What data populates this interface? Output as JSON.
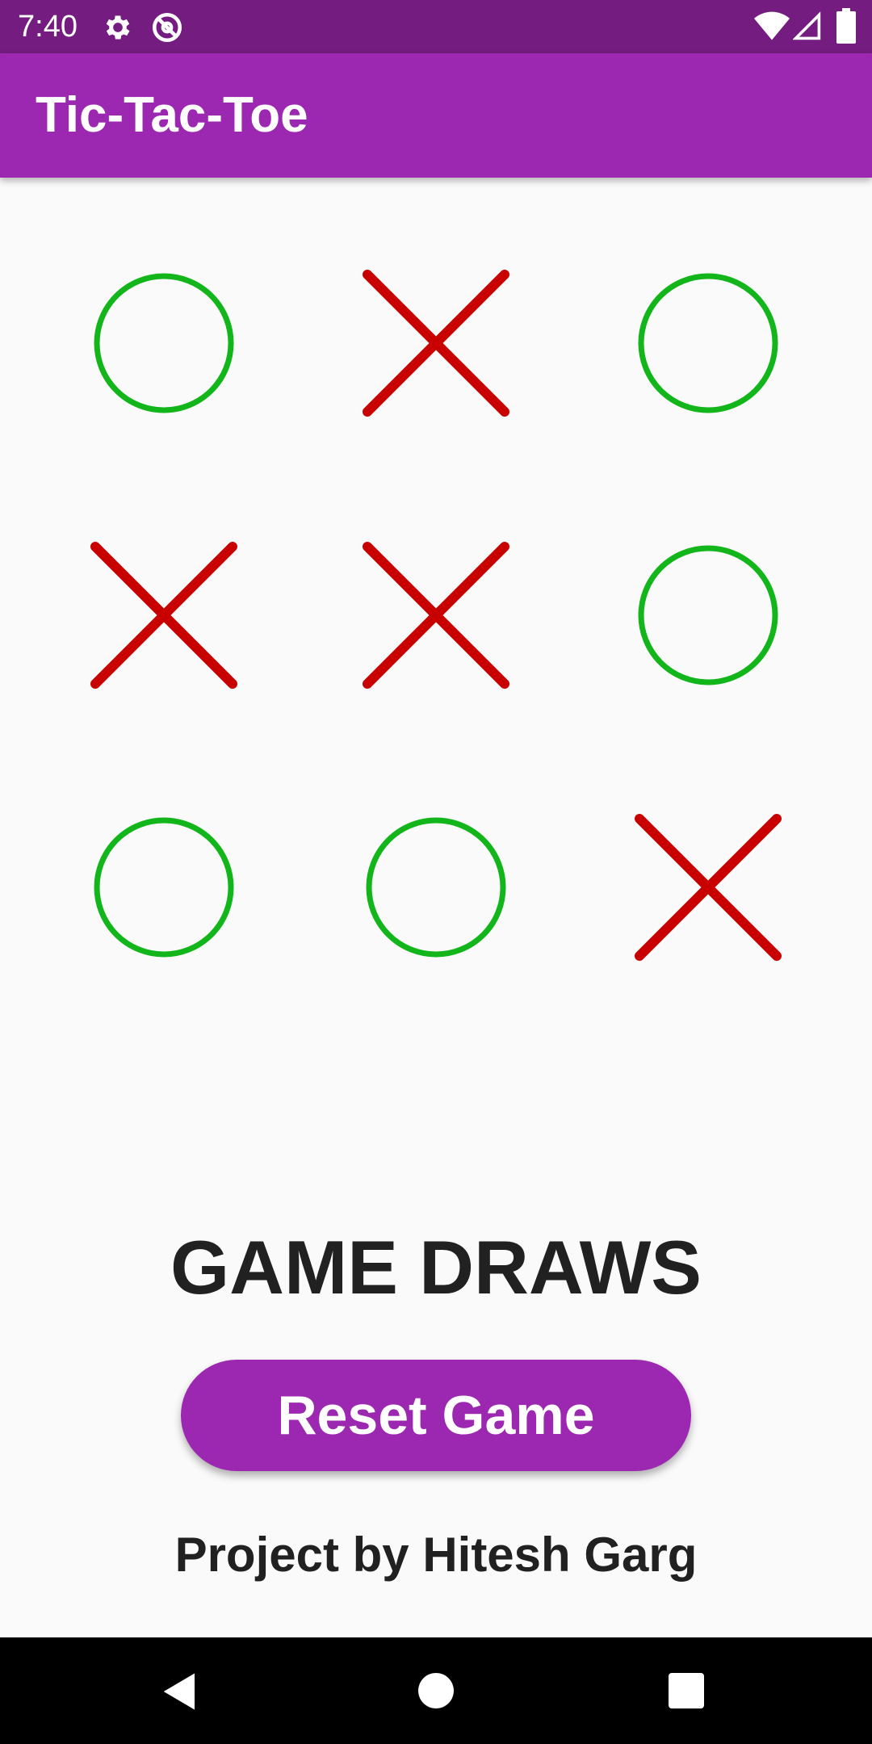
{
  "status_bar": {
    "time": "7:40",
    "icons_left": [
      "settings-gear-icon",
      "at-sign-icon"
    ],
    "icons_right": [
      "wifi-icon",
      "signal-icon",
      "battery-icon"
    ]
  },
  "app_bar": {
    "title": "Tic-Tac-Toe",
    "color": "#9c27b0"
  },
  "board": {
    "cells": [
      "O",
      "X",
      "O",
      "X",
      "X",
      "O",
      "O",
      "O",
      "X"
    ],
    "o_color": "#12b51a",
    "x_color": "#c80000"
  },
  "result": {
    "text": "GAME DRAWS"
  },
  "reset_button": {
    "label": "Reset Game"
  },
  "footer": {
    "credit": "Project by Hitesh Garg"
  },
  "nav_bar": {
    "buttons": [
      "back-icon",
      "home-icon",
      "recents-icon"
    ]
  }
}
